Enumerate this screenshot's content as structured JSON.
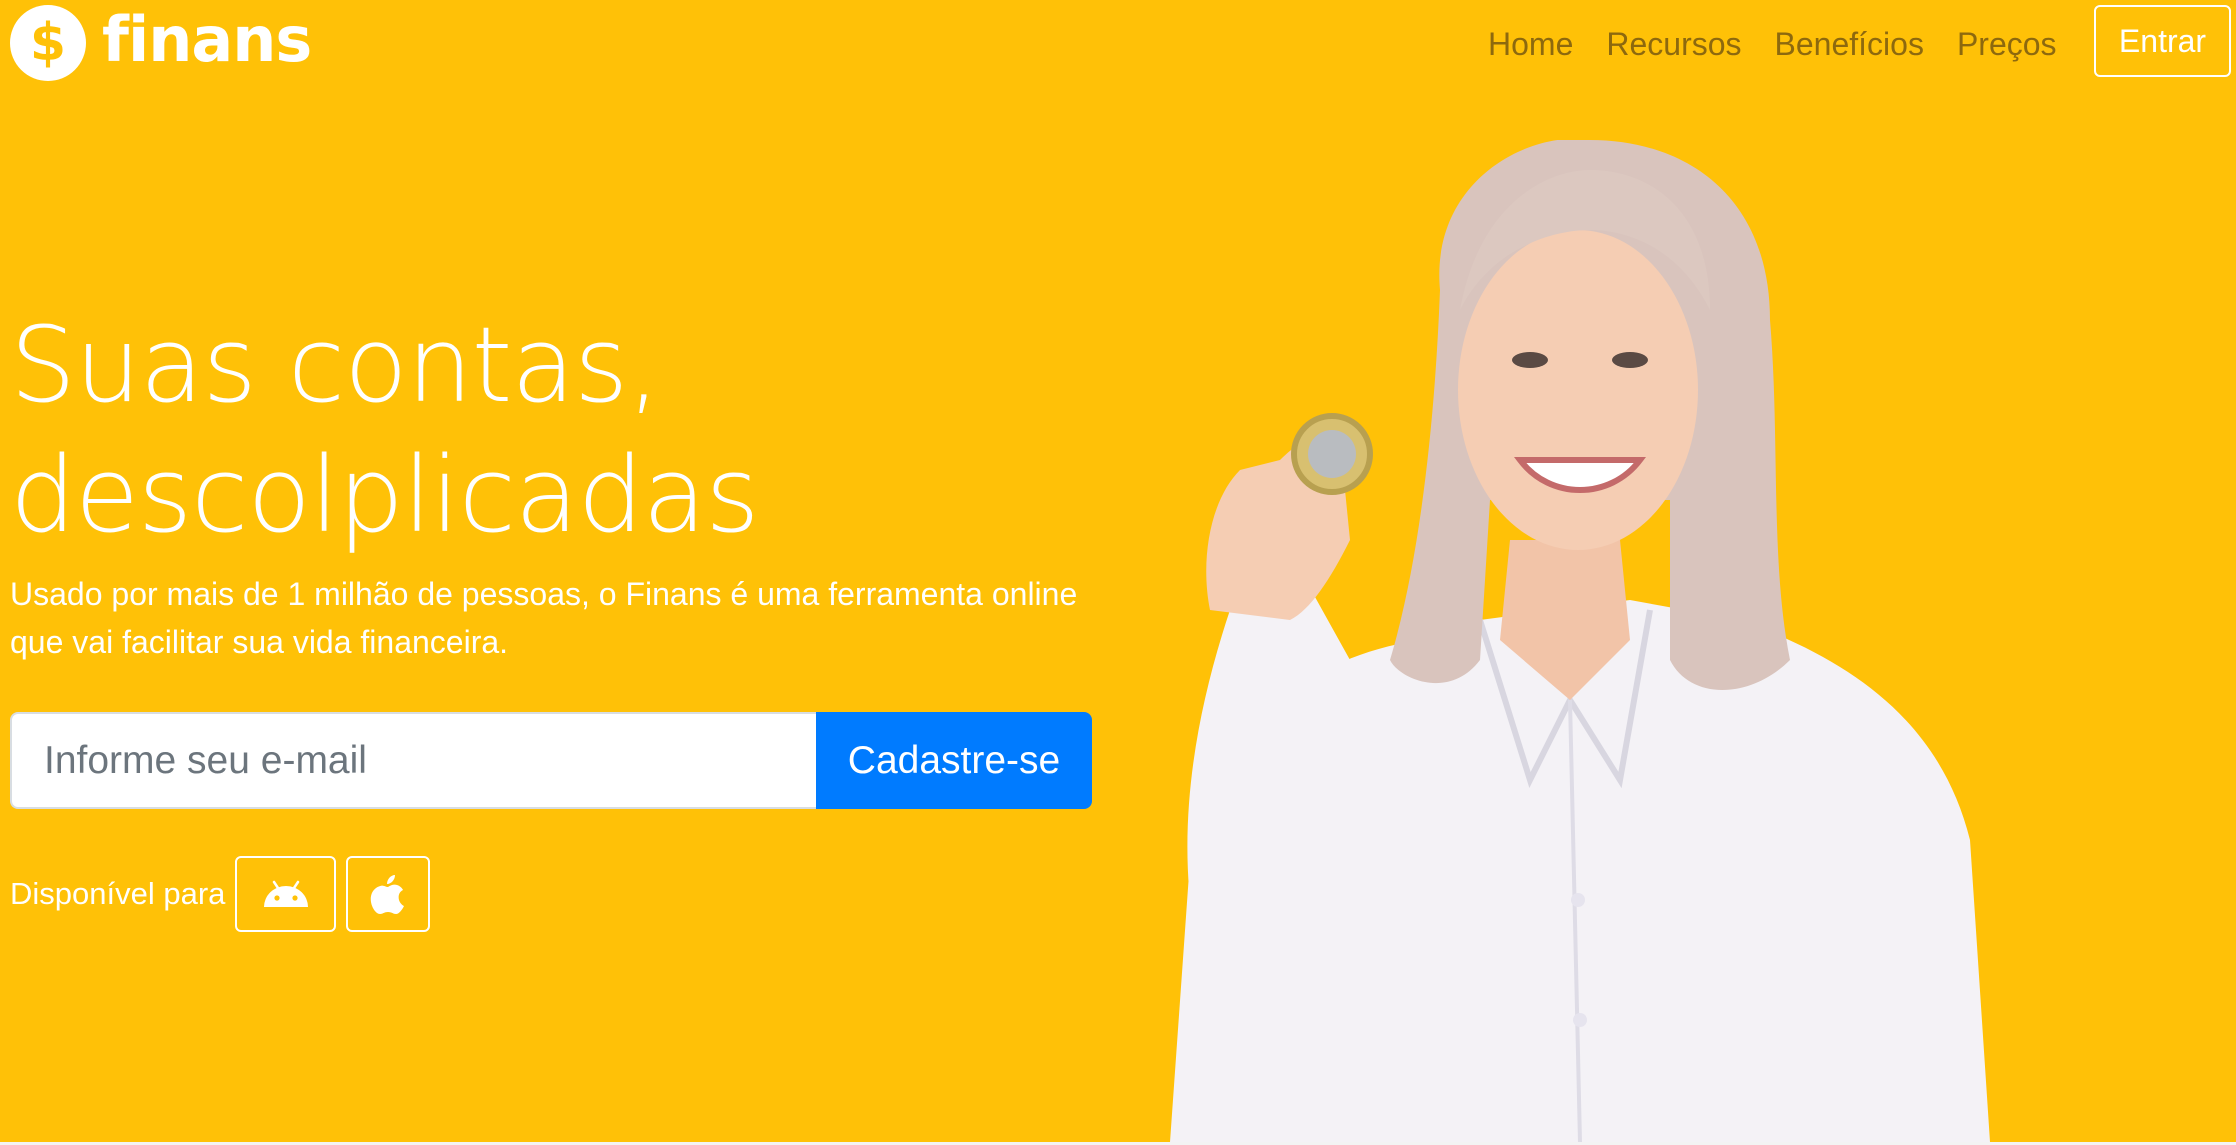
{
  "brand": {
    "icon": "dollar-coin-icon",
    "icon_glyph": "$",
    "name": "finans"
  },
  "nav": {
    "links": [
      "Home",
      "Recursos",
      "Benefícios",
      "Preços"
    ],
    "login_label": "Entrar"
  },
  "hero": {
    "headline_line1": "Suas contas,",
    "headline_line2": "descolplicadas",
    "lead_line1": "Usado por mais de 1 milhão de pessoas, o Finans é uma ferramenta online",
    "lead_line2": "que vai facilitar sua vida financeira.",
    "email_placeholder": "Informe seu e-mail",
    "signup_label": "Cadastre-se",
    "availability_label": "Disponível para",
    "stores": [
      {
        "icon": "android-icon"
      },
      {
        "icon": "apple-icon"
      }
    ],
    "photo": "smiling-woman-holding-coin"
  },
  "colors": {
    "background": "#ffc107",
    "primary_button": "#007bff",
    "text_light": "#ffffff",
    "nav_text": "#7a5a10"
  }
}
